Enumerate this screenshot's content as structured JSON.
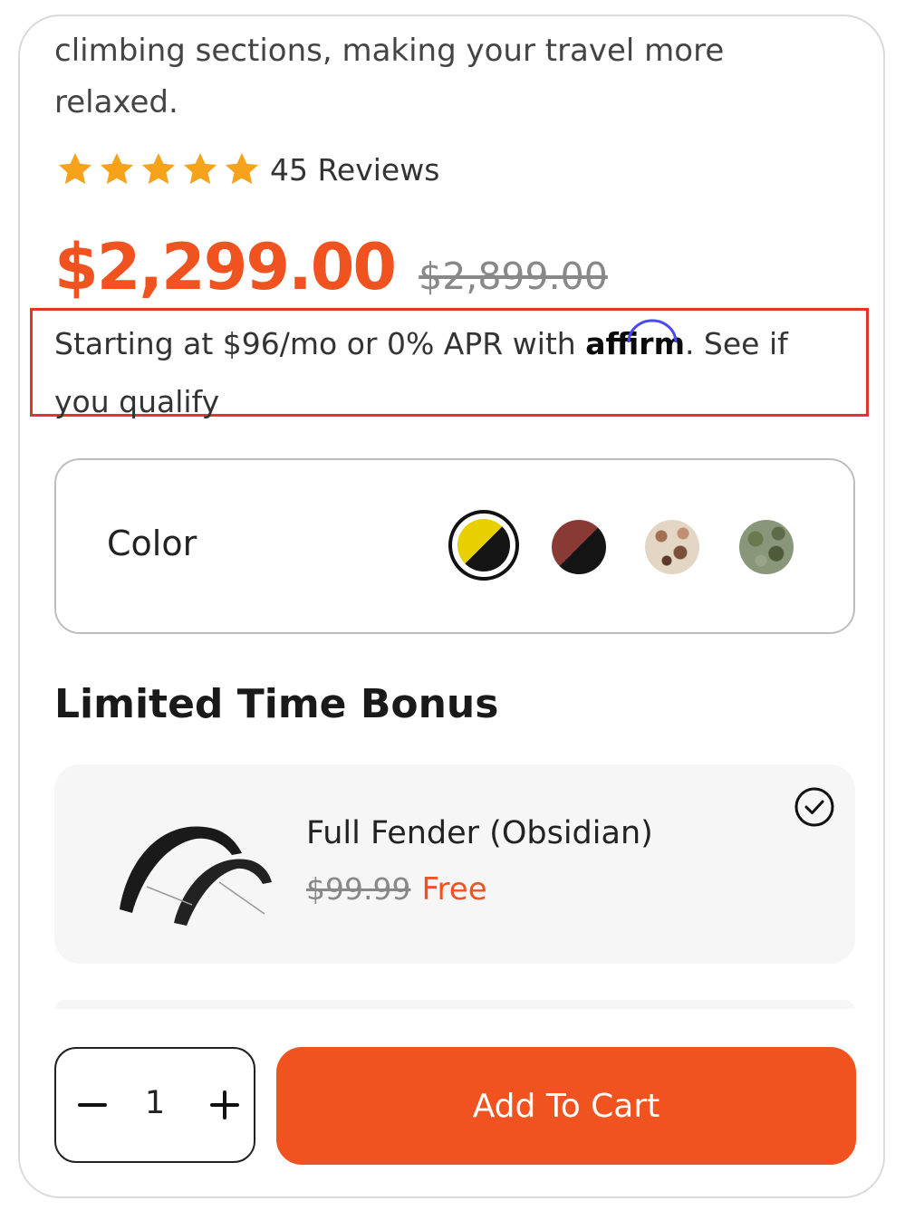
{
  "product": {
    "description_tail": "climbing sections, making your travel more relaxed.",
    "rating": {
      "stars": 5,
      "reviews_label": "45 Reviews"
    },
    "price": "$2,299.00",
    "compare_price": "$2,899.00"
  },
  "financing": {
    "prefix": "Starting at $96/mo or 0% APR with",
    "brand": "affirm",
    "link_text": ". See if you qualify"
  },
  "color_selector": {
    "label": "Color",
    "options": [
      {
        "name": "yellow-black",
        "selected": true
      },
      {
        "name": "red-black",
        "selected": false
      },
      {
        "name": "desert-camo",
        "selected": false
      },
      {
        "name": "green-camo",
        "selected": false
      }
    ]
  },
  "bonus": {
    "title": "Limited Time Bonus",
    "item_name": "Full Fender (Obsidian)",
    "old_price": "$99.99",
    "new_price": "Free",
    "selected": true
  },
  "cart": {
    "quantity": "1",
    "add_label": "Add To Cart"
  },
  "colors": {
    "accent": "#f05320",
    "star": "#f7a21b",
    "highlight_border": "#e5342b"
  }
}
